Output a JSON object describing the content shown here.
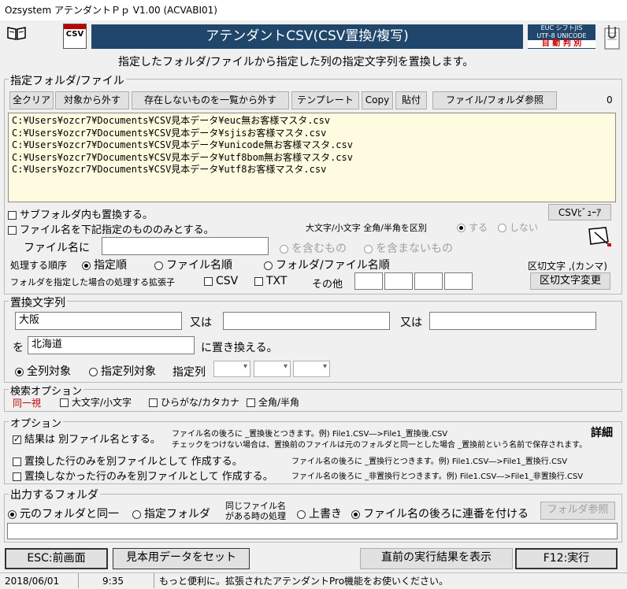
{
  "window": {
    "title": "Ozsystem アテンダントＰｐ V1.00 (ACVABI01)"
  },
  "header": {
    "banner_title": "アテンダントCSV(CSV置換/複写)",
    "csv_icon_label": "CSV",
    "encoding_badge": {
      "line1": "EUC  シフトJIS",
      "line2": "UTF-8 UNICODE",
      "line3": "自 動 判 別"
    },
    "description": "指定したフォルダ/ファイルから指定した列の指定文字列を置換します。"
  },
  "folder_section": {
    "label": "指定フォルダ/ファイル",
    "buttons": {
      "clear_all": "全クリア",
      "remove": "対象から外す",
      "remove_missing": "存在しないものを一覧から外す",
      "template": "テンプレート",
      "copy": "Copy",
      "paste": "貼付",
      "browse": "ファイル/フォルダ参照"
    },
    "count": "0",
    "files": [
      "C:¥Users¥ozcr7¥Documents¥CSV見本データ¥euc無お客様マスタ.csv",
      "C:¥Users¥ozcr7¥Documents¥CSV見本データ¥sjisお客様マスタ.csv",
      "C:¥Users¥ozcr7¥Documents¥CSV見本データ¥unicode無お客様マスタ.csv",
      "C:¥Users¥ozcr7¥Documents¥CSV見本データ¥utf8bom無お客様マスタ.csv",
      "C:¥Users¥ozcr7¥Documents¥CSV見本データ¥utf8お客様マスタ.csv"
    ],
    "subfolder": "サブフォルダ内も置換する。",
    "filename_filter": "ファイル名を下記指定のもののみとする。",
    "csv_viewer": "CSVﾋﾞｭｰｱ",
    "case_label": "大文字/小文字 全角/半角を区別",
    "case_yes": "する",
    "case_no": "しない",
    "filename_label": "ファイル名に",
    "filename_value": "",
    "contains": "を含むもの",
    "not_contains": "を含まないもの",
    "order_label": "処理する順序",
    "order_specified": "指定順",
    "order_filename": "ファイル名順",
    "order_folder_filename": "フォルダ/ファイル名順",
    "delimiter_label": "区切文字 ,(カンマ)",
    "ext_label": "フォルダを指定した場合の処理する拡張子",
    "ext_csv": "CSV",
    "ext_txt": "TXT",
    "ext_other": "その他",
    "delimiter_change": "区切文字変更"
  },
  "replace_section": {
    "label": "置換文字列",
    "value1": "大阪",
    "or1": "又は",
    "value2": "",
    "or2": "又は",
    "value3": "",
    "wo": "を",
    "replace_with": "北海道",
    "replace_suffix": "に置き換える。",
    "all_columns": "全列対象",
    "specified_columns": "指定列対象",
    "column_label": "指定列"
  },
  "search_section": {
    "label": "検索オプション",
    "same_label": "同一視",
    "case": "大文字/小文字",
    "kana": "ひらがな/カタカナ",
    "width": "全角/半角"
  },
  "options_section": {
    "label": "オプション",
    "result_separate": "結果は 別ファイル名とする。",
    "result_note1": "ファイル名の後ろに _置換後とつきます。例) File1.CSV―>File1_置換後.CSV",
    "result_note2": "チェックをつけない場合は、置換前のファイルは元のフォルダと同一とした場合 _置換前という名前で保存されます。",
    "details": "詳細",
    "only_replaced": "置換した行のみを別ファイルとして 作成する。",
    "only_replaced_note": "ファイル名の後ろに _置換行とつきます。例) File1.CSV―>File1_置換行.CSV",
    "only_unreplaced": "置換しなかった行のみを別ファイルとして 作成する。",
    "only_unreplaced_note": "ファイル名の後ろに _非置換行とつきます。例) File1.CSV―>File1_非置換行.CSV"
  },
  "output_section": {
    "label": "出力するフォルダ",
    "same_folder": "元のフォルダと同一",
    "specified_folder": "指定フォルダ",
    "same_name_line1": "同じファイル名",
    "same_name_line2": "がある時の処理",
    "overwrite": "上書き",
    "sequence": "ファイル名の後ろに連番を付ける",
    "folder_browse": "フォルダ参照",
    "path_value": ""
  },
  "footer": {
    "esc": "ESC:前画面",
    "sample": "見本用データをセット",
    "show_last": "直前の実行結果を表示",
    "run": "F12:実行"
  },
  "statusbar": {
    "date": "2018/06/01",
    "time": "9:35",
    "message": "もっと便利に。拡張されたアテンダントPro機能をお使いください。"
  }
}
